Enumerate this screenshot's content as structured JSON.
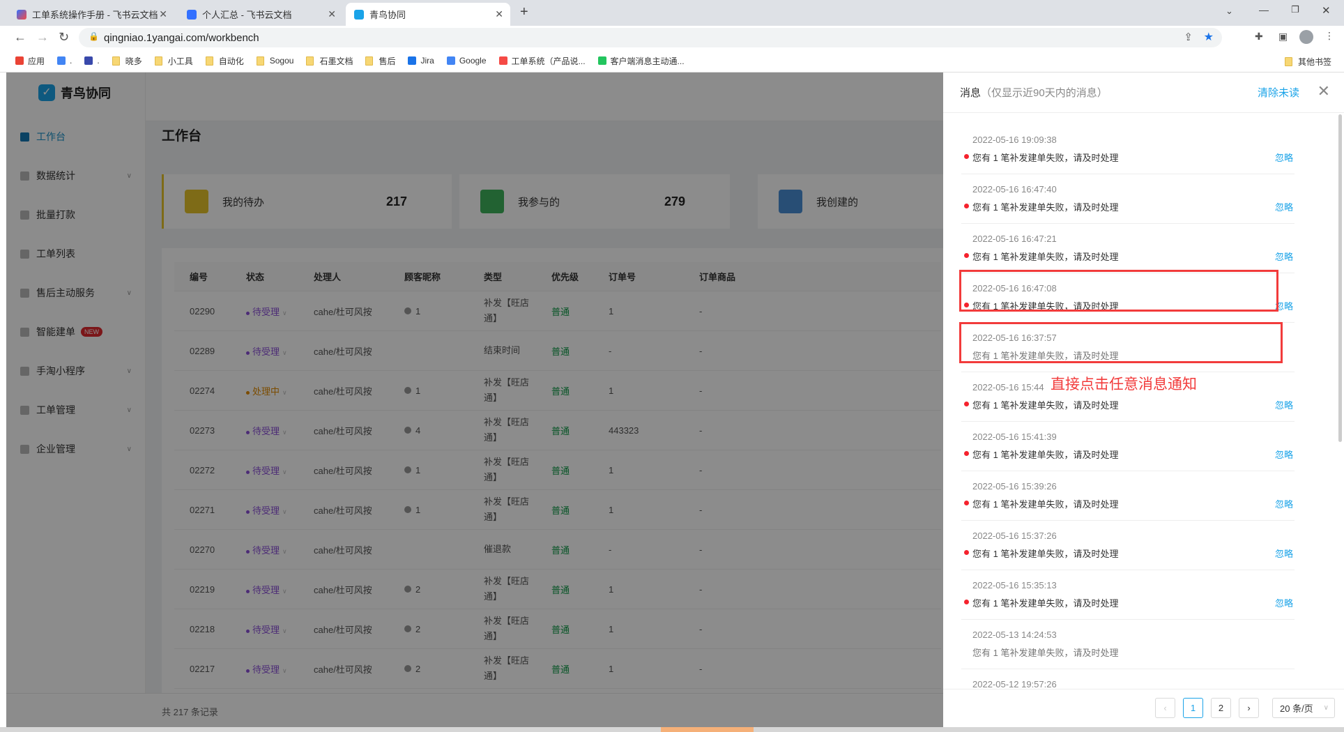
{
  "browser": {
    "tabs": [
      {
        "title": "工单系统操作手册 - 飞书云文档",
        "icon": "feishu-icon"
      },
      {
        "title": "个人汇总 - 飞书云文档",
        "icon": "feishu-doc-icon"
      },
      {
        "title": "青鸟协同",
        "icon": "qingniao-icon",
        "active": true
      }
    ],
    "url": "qingniao.1yangai.com/workbench",
    "bookmarks": [
      "应用",
      ".",
      ".",
      "晓多",
      "小工具",
      "自动化",
      "Sogou",
      "石墨文档",
      "售后",
      "Jira",
      "Google",
      "工单系统（产品说...",
      "客户端消息主动通..."
    ],
    "other_bookmarks": "其他书签"
  },
  "app": {
    "logo": "青鸟协同",
    "sidebar": [
      {
        "label": "工作台",
        "active": true
      },
      {
        "label": "数据统计",
        "chevron": true
      },
      {
        "label": "批量打款"
      },
      {
        "label": "工单列表"
      },
      {
        "label": "售后主动服务",
        "chevron": true
      },
      {
        "label": "智能建单",
        "badge": "NEW"
      },
      {
        "label": "手淘小程序",
        "chevron": true
      },
      {
        "label": "工单管理",
        "chevron": true
      },
      {
        "label": "企业管理",
        "chevron": true
      }
    ],
    "page_title": "工作台",
    "cards": [
      {
        "label": "我的待办",
        "count": "217",
        "color": "#e6c42a"
      },
      {
        "label": "我参与的",
        "count": "279",
        "color": "#3fb35c"
      },
      {
        "label": "我创建的",
        "count": "",
        "color": "#4a8ed6"
      }
    ],
    "table": {
      "columns": [
        "编号",
        "状态",
        "处理人",
        "顾客昵称",
        "类型",
        "优先级",
        "订单号",
        "订单商品"
      ],
      "rows": [
        [
          "02290",
          "待受理",
          "cahe/杜可风按",
          "1",
          "补发【旺店通】",
          "普通",
          "1",
          "-"
        ],
        [
          "02289",
          "待受理",
          "cahe/杜可风按",
          "",
          "结束时间",
          "普通",
          "-",
          "-"
        ],
        [
          "02274",
          "处理中",
          "cahe/杜可风按",
          "1",
          "补发【旺店通】",
          "普通",
          "1",
          "-"
        ],
        [
          "02273",
          "待受理",
          "cahe/杜可风按",
          "4",
          "补发【旺店通】",
          "普通",
          "443323",
          "-"
        ],
        [
          "02272",
          "待受理",
          "cahe/杜可风按",
          "1",
          "补发【旺店通】",
          "普通",
          "1",
          "-"
        ],
        [
          "02271",
          "待受理",
          "cahe/杜可风按",
          "1",
          "补发【旺店通】",
          "普通",
          "1",
          "-"
        ],
        [
          "02270",
          "待受理",
          "cahe/杜可风按",
          "",
          "催退款",
          "普通",
          "-",
          "-"
        ],
        [
          "02219",
          "待受理",
          "cahe/杜可风按",
          "2",
          "补发【旺店通】",
          "普通",
          "1",
          "-"
        ],
        [
          "02218",
          "待受理",
          "cahe/杜可风按",
          "2",
          "补发【旺店通】",
          "普通",
          "1",
          "-"
        ],
        [
          "02217",
          "待受理",
          "cahe/杜可风按",
          "2",
          "补发【旺店通】",
          "普通",
          "1",
          "-"
        ]
      ],
      "total": "共 217 条记录"
    }
  },
  "drawer": {
    "title": "消息",
    "subtitle": "（仅显示近90天内的消息）",
    "clear_label": "清除未读",
    "ignore_label": "忽略",
    "messages": [
      {
        "date": "2022-05-16 19:09:38",
        "text": "您有 1 笔补发建单失败，请及时处理",
        "unread": true
      },
      {
        "date": "2022-05-16 16:47:40",
        "text": "您有 1 笔补发建单失败，请及时处理",
        "unread": true
      },
      {
        "date": "2022-05-16 16:47:21",
        "text": "您有 1 笔补发建单失败，请及时处理",
        "unread": true
      },
      {
        "date": "2022-05-16 16:47:08",
        "text": "您有 1 笔补发建单失败，请及时处理",
        "unread": true
      },
      {
        "date": "2022-05-16 16:37:57",
        "text": "您有 1 笔补发建单失败，请及时处理",
        "unread": false
      },
      {
        "date": "2022-05-16 15:44",
        "text": "您有 1 笔补发建单失败，请及时处理",
        "unread": true
      },
      {
        "date": "2022-05-16 15:41:39",
        "text": "您有 1 笔补发建单失败，请及时处理",
        "unread": true
      },
      {
        "date": "2022-05-16 15:39:26",
        "text": "您有 1 笔补发建单失败，请及时处理",
        "unread": true
      },
      {
        "date": "2022-05-16 15:37:26",
        "text": "您有 1 笔补发建单失败，请及时处理",
        "unread": true
      },
      {
        "date": "2022-05-16 15:35:13",
        "text": "您有 1 笔补发建单失败，请及时处理",
        "unread": true
      },
      {
        "date": "2022-05-13 14:24:53",
        "text": "您有 1 笔补发建单失败，请及时处理",
        "unread": false
      },
      {
        "date": "2022-05-12 19:57:26",
        "text": "",
        "unread": false
      }
    ],
    "pagination": {
      "pages": [
        "1",
        "2"
      ],
      "current": "1",
      "page_size": "20 条/页"
    },
    "annotation": "直接点击任意消息通知"
  },
  "colors": {
    "accent": "#1aa3e8",
    "unread_dot": "#f5222d",
    "annotation": "#f23b3b",
    "status_pending": "#8a4fd8",
    "status_processing": "#e08a00",
    "priority": "#0f9b48"
  }
}
